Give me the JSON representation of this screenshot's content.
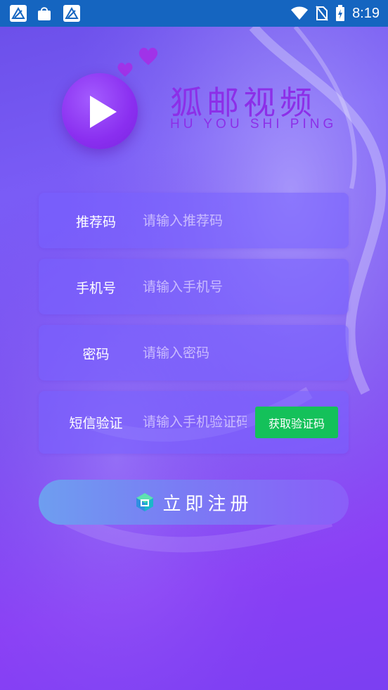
{
  "status_bar": {
    "time": "8:19",
    "left_icons": [
      "app-notification-icon",
      "app-store-icon",
      "app-notification-icon"
    ],
    "right_icons": [
      "wifi-icon",
      "no-sim-icon",
      "battery-charging-icon"
    ]
  },
  "brand": {
    "title": "狐邮视频",
    "subtitle": "HU YOU SHI PING",
    "logo_icon": "play-icon"
  },
  "form": {
    "referral": {
      "label": "推荐码",
      "placeholder": "请输入推荐码",
      "value": ""
    },
    "phone": {
      "label": "手机号",
      "placeholder": "请输入手机号",
      "value": ""
    },
    "password": {
      "label": "密码",
      "placeholder": "请输入密码",
      "value": ""
    },
    "sms": {
      "label": "短信验证",
      "placeholder": "请输入手机验证码",
      "value": "",
      "get_code_label": "获取验证码"
    }
  },
  "register_button": {
    "label": "立即注册",
    "icon": "cube-icon"
  },
  "colors": {
    "status_bar": "#1565c0",
    "brand": "#8c2fe8",
    "get_code_button": "#14c15a"
  }
}
